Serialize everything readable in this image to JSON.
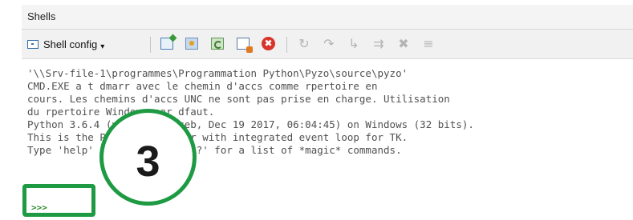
{
  "panel": {
    "title": "Shells"
  },
  "toolbar": {
    "shell_config_label": "Shell config",
    "shell_config_arrow": "▾",
    "icons": {
      "stop": "✖",
      "interrupt": "↻",
      "step_over": "↷",
      "step_into": "↳",
      "step_out": "⇉",
      "stop_debug": "✖",
      "stack": "≡"
    }
  },
  "shell": {
    "lines": [
      "'\\\\Srv-file-1\\programmes\\Programmation Python\\Pyzo\\source\\pyzo'",
      "CMD.EXE a t dmarr avec le chemin d'accs comme rpertoire en",
      "cours. Les chemins d'accs UNC ne sont pas prise en charge. Utilisation",
      "du rpertoire Windows par dfaut.",
      "Python 3.6.4 (v3.6.4:d48eceb, Dec 19 2017, 06:04:45) on Windows (32 bits).",
      "This is the Pyzo interpreter with integrated event loop for TK.",
      "Type 'help' for help, type '?' for a list of *magic* commands."
    ],
    "prompt": ">>>"
  },
  "annotation": {
    "step_number": "3"
  },
  "colors": {
    "annotation_green": "#1e9a43",
    "prompt_green": "#2b8a2b"
  }
}
